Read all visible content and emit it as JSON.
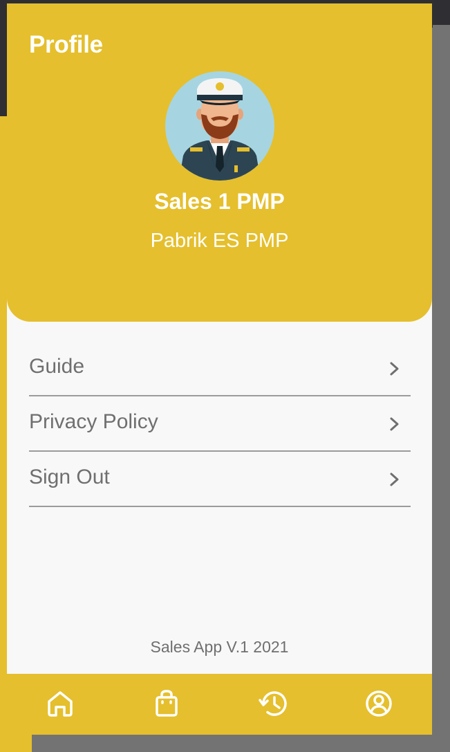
{
  "colors": {
    "accent": "#e5bf2d",
    "background": "#f8f8f8",
    "text_muted": "#6f6f6f",
    "divider": "#9b9b9b"
  },
  "header": {
    "title": "Profile",
    "avatar_icon": "captain-avatar-icon"
  },
  "profile": {
    "name": "Sales 1 PMP",
    "company": "Pabrik ES PMP"
  },
  "menu": {
    "items": [
      {
        "label": "Guide",
        "icon": "chevron-right-icon"
      },
      {
        "label": "Privacy Policy",
        "icon": "chevron-right-icon"
      },
      {
        "label": "Sign Out",
        "icon": "chevron-right-icon"
      }
    ]
  },
  "footer": {
    "version": "Sales App V.1 2021"
  },
  "bottom_nav": {
    "items": [
      {
        "icon": "home-icon"
      },
      {
        "icon": "shopping-bag-icon"
      },
      {
        "icon": "history-icon"
      },
      {
        "icon": "account-icon"
      }
    ]
  }
}
